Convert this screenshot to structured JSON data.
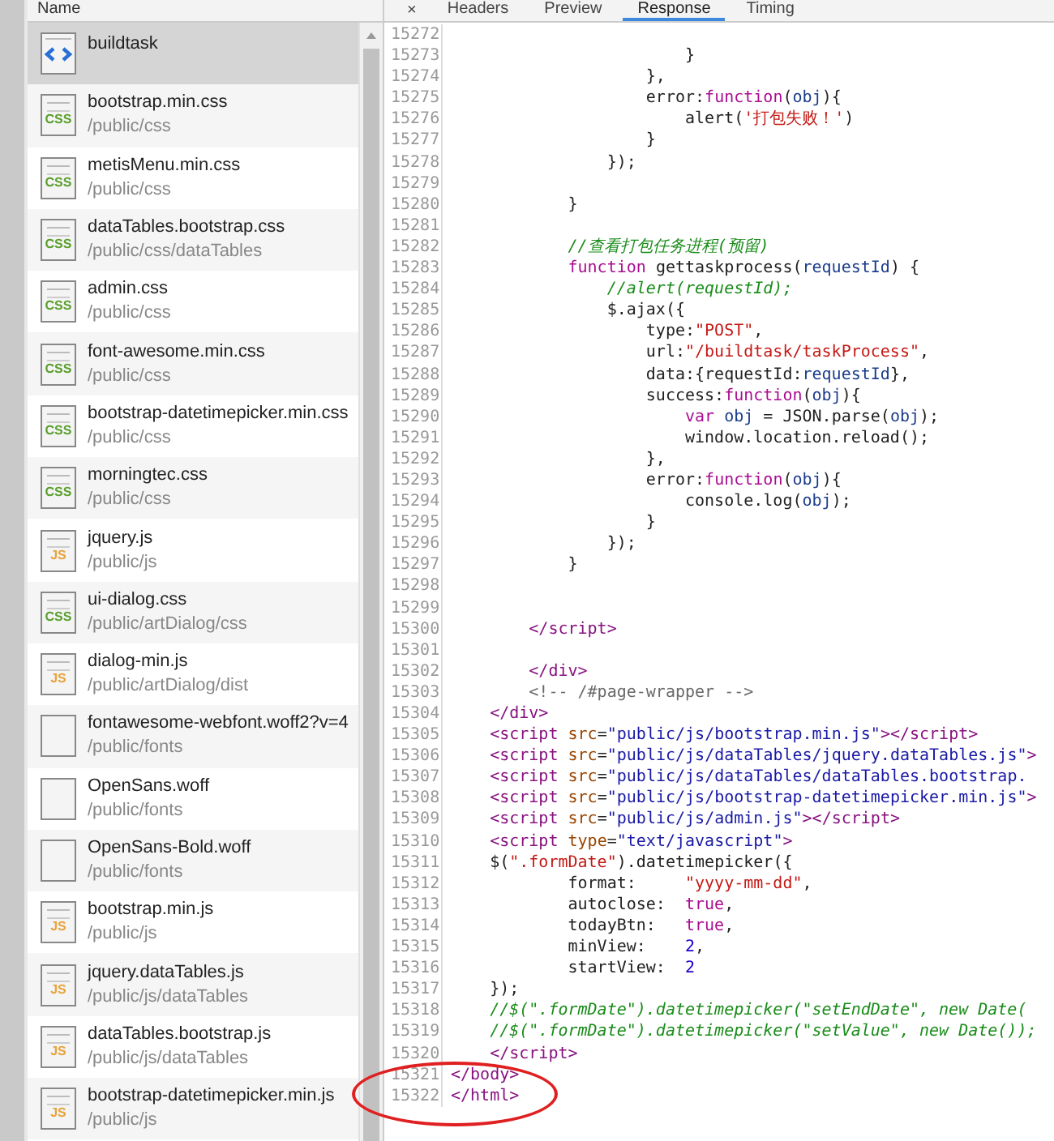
{
  "network_panel": {
    "header": "Name",
    "requests": [
      {
        "name": "buildtask",
        "kind": "html",
        "selected": true
      },
      {
        "name": "bootstrap.min.css",
        "path": "/public/css",
        "kind": "css",
        "icon_text": "CSS",
        "selected": false
      },
      {
        "name": "metisMenu.min.css",
        "path": "/public/css",
        "kind": "css",
        "icon_text": "CSS",
        "selected": false
      },
      {
        "name": "dataTables.bootstrap.css",
        "path": "/public/css/dataTables",
        "kind": "css",
        "icon_text": "CSS",
        "selected": false
      },
      {
        "name": "admin.css",
        "path": "/public/css",
        "kind": "css",
        "icon_text": "CSS",
        "selected": false
      },
      {
        "name": "font-awesome.min.css",
        "path": "/public/css",
        "kind": "css",
        "icon_text": "CSS",
        "selected": false
      },
      {
        "name": "bootstrap-datetimepicker.min.css",
        "path": "/public/css",
        "kind": "css",
        "icon_text": "CSS",
        "selected": false
      },
      {
        "name": "morningtec.css",
        "path": "/public/css",
        "kind": "css",
        "icon_text": "CSS",
        "selected": false
      },
      {
        "name": "jquery.js",
        "path": "/public/js",
        "kind": "js",
        "icon_text": "JS",
        "selected": false
      },
      {
        "name": "ui-dialog.css",
        "path": "/public/artDialog/css",
        "kind": "css",
        "icon_text": "CSS",
        "selected": false
      },
      {
        "name": "dialog-min.js",
        "path": "/public/artDialog/dist",
        "kind": "js",
        "icon_text": "JS",
        "selected": false
      },
      {
        "name": "fontawesome-webfont.woff2?v=4",
        "path": "/public/fonts",
        "kind": "font",
        "selected": false
      },
      {
        "name": "OpenSans.woff",
        "path": "/public/fonts",
        "kind": "font",
        "selected": false
      },
      {
        "name": "OpenSans-Bold.woff",
        "path": "/public/fonts",
        "kind": "font",
        "selected": false
      },
      {
        "name": "bootstrap.min.js",
        "path": "/public/js",
        "kind": "js",
        "icon_text": "JS",
        "selected": false
      },
      {
        "name": "jquery.dataTables.js",
        "path": "/public/js/dataTables",
        "kind": "js",
        "icon_text": "JS",
        "selected": false
      },
      {
        "name": "dataTables.bootstrap.js",
        "path": "/public/js/dataTables",
        "kind": "js",
        "icon_text": "JS",
        "selected": false
      },
      {
        "name": "bootstrap-datetimepicker.min.js",
        "path": "/public/js",
        "kind": "js",
        "icon_text": "JS",
        "selected": false
      }
    ]
  },
  "detail_panel": {
    "close": "×",
    "tabs": [
      {
        "label": "Headers",
        "selected": false
      },
      {
        "label": "Preview",
        "selected": false
      },
      {
        "label": "Response",
        "selected": true
      },
      {
        "label": "Timing",
        "selected": false
      }
    ],
    "code_lines": [
      {
        "number": "15272"
      },
      {
        "number": "15273",
        "tokens": [
          {
            "kind": "plain",
            "text": "                        }"
          }
        ]
      },
      {
        "number": "15274",
        "tokens": [
          {
            "kind": "plain",
            "text": "                    },"
          }
        ]
      },
      {
        "number": "15275",
        "tokens": [
          {
            "kind": "plain",
            "text": "                    error:"
          },
          {
            "kind": "keyword",
            "text": "function"
          },
          {
            "kind": "plain",
            "text": "("
          },
          {
            "kind": "ident",
            "text": "obj"
          },
          {
            "kind": "plain",
            "text": "){"
          }
        ]
      },
      {
        "number": "15276",
        "tokens": [
          {
            "kind": "plain",
            "text": "                        alert("
          },
          {
            "kind": "string",
            "text": "'打包失败！'"
          },
          {
            "kind": "plain",
            "text": ")"
          }
        ]
      },
      {
        "number": "15277",
        "tokens": [
          {
            "kind": "plain",
            "text": "                    }"
          }
        ]
      },
      {
        "number": "15278",
        "tokens": [
          {
            "kind": "plain",
            "text": "                });"
          }
        ]
      },
      {
        "number": "15279"
      },
      {
        "number": "15280",
        "tokens": [
          {
            "kind": "plain",
            "text": "            }"
          }
        ]
      },
      {
        "number": "15281"
      },
      {
        "number": "15282",
        "tokens": [
          {
            "kind": "comment",
            "text": "            //查看打包任务进程(预留)"
          }
        ]
      },
      {
        "number": "15283",
        "tokens": [
          {
            "kind": "keyword",
            "text": "            function"
          },
          {
            "kind": "plain",
            "text": " gettaskprocess("
          },
          {
            "kind": "ident",
            "text": "requestId"
          },
          {
            "kind": "plain",
            "text": ") {"
          }
        ]
      },
      {
        "number": "15284",
        "tokens": [
          {
            "kind": "comment",
            "text": "                //alert(requestId);"
          }
        ]
      },
      {
        "number": "15285",
        "tokens": [
          {
            "kind": "plain",
            "text": "                $.ajax({"
          }
        ]
      },
      {
        "number": "15286",
        "tokens": [
          {
            "kind": "plain",
            "text": "                    type:"
          },
          {
            "kind": "string",
            "text": "\"POST\""
          },
          {
            "kind": "plain",
            "text": ","
          }
        ]
      },
      {
        "number": "15287",
        "tokens": [
          {
            "kind": "plain",
            "text": "                    url:"
          },
          {
            "kind": "string",
            "text": "\"/buildtask/taskProcess\""
          },
          {
            "kind": "plain",
            "text": ","
          }
        ]
      },
      {
        "number": "15288",
        "tokens": [
          {
            "kind": "plain",
            "text": "                    data:{requestId:"
          },
          {
            "kind": "ident",
            "text": "requestId"
          },
          {
            "kind": "plain",
            "text": "},"
          }
        ]
      },
      {
        "number": "15289",
        "tokens": [
          {
            "kind": "plain",
            "text": "                    success:"
          },
          {
            "kind": "keyword",
            "text": "function"
          },
          {
            "kind": "plain",
            "text": "("
          },
          {
            "kind": "ident",
            "text": "obj"
          },
          {
            "kind": "plain",
            "text": "){"
          }
        ]
      },
      {
        "number": "15290",
        "tokens": [
          {
            "kind": "keyword",
            "text": "                        var"
          },
          {
            "kind": "ident",
            "text": " obj"
          },
          {
            "kind": "plain",
            "text": " = JSON.parse("
          },
          {
            "kind": "ident",
            "text": "obj"
          },
          {
            "kind": "plain",
            "text": ");"
          }
        ]
      },
      {
        "number": "15291",
        "tokens": [
          {
            "kind": "plain",
            "text": "                        window.location.reload();"
          }
        ]
      },
      {
        "number": "15292",
        "tokens": [
          {
            "kind": "plain",
            "text": "                    },"
          }
        ]
      },
      {
        "number": "15293",
        "tokens": [
          {
            "kind": "plain",
            "text": "                    error:"
          },
          {
            "kind": "keyword",
            "text": "function"
          },
          {
            "kind": "plain",
            "text": "("
          },
          {
            "kind": "ident",
            "text": "obj"
          },
          {
            "kind": "plain",
            "text": "){"
          }
        ]
      },
      {
        "number": "15294",
        "tokens": [
          {
            "kind": "plain",
            "text": "                        console.log("
          },
          {
            "kind": "ident",
            "text": "obj"
          },
          {
            "kind": "plain",
            "text": ");"
          }
        ]
      },
      {
        "number": "15295",
        "tokens": [
          {
            "kind": "plain",
            "text": "                    }"
          }
        ]
      },
      {
        "number": "15296",
        "tokens": [
          {
            "kind": "plain",
            "text": "                });"
          }
        ]
      },
      {
        "number": "15297",
        "tokens": [
          {
            "kind": "plain",
            "text": "            }"
          }
        ]
      },
      {
        "number": "15298"
      },
      {
        "number": "15299"
      },
      {
        "number": "15300",
        "tokens": [
          {
            "kind": "tag",
            "text": "        </script>"
          }
        ]
      },
      {
        "number": "15301"
      },
      {
        "number": "15302",
        "tokens": [
          {
            "kind": "tag",
            "text": "        </div>"
          }
        ]
      },
      {
        "number": "15303",
        "tokens": [
          {
            "kind": "html-comment",
            "text": "        <!-- /#page-wrapper -->"
          }
        ]
      },
      {
        "number": "15304",
        "tokens": [
          {
            "kind": "tag",
            "text": "    </div>"
          }
        ]
      },
      {
        "number": "15305",
        "tokens": [
          {
            "kind": "tag",
            "text": "    <script"
          },
          {
            "kind": "attr",
            "text": " src"
          },
          {
            "kind": "plain",
            "text": "="
          },
          {
            "kind": "value",
            "text": "\"public/js/bootstrap.min.js\""
          },
          {
            "kind": "tag",
            "text": "></script>"
          }
        ]
      },
      {
        "number": "15306",
        "tokens": [
          {
            "kind": "tag",
            "text": "    <script"
          },
          {
            "kind": "attr",
            "text": " src"
          },
          {
            "kind": "plain",
            "text": "="
          },
          {
            "kind": "value",
            "text": "\"public/js/dataTables/jquery.dataTables.js\""
          },
          {
            "kind": "tag",
            "text": ">"
          }
        ]
      },
      {
        "number": "15307",
        "tokens": [
          {
            "kind": "tag",
            "text": "    <script"
          },
          {
            "kind": "attr",
            "text": " src"
          },
          {
            "kind": "plain",
            "text": "="
          },
          {
            "kind": "value",
            "text": "\"public/js/dataTables/dataTables.bootstrap."
          }
        ]
      },
      {
        "number": "15308",
        "tokens": [
          {
            "kind": "tag",
            "text": "    <script"
          },
          {
            "kind": "attr",
            "text": " src"
          },
          {
            "kind": "plain",
            "text": "="
          },
          {
            "kind": "value",
            "text": "\"public/js/bootstrap-datetimepicker.min.js\""
          },
          {
            "kind": "tag",
            "text": ">"
          }
        ]
      },
      {
        "number": "15309",
        "tokens": [
          {
            "kind": "tag",
            "text": "    <script"
          },
          {
            "kind": "attr",
            "text": " src"
          },
          {
            "kind": "plain",
            "text": "="
          },
          {
            "kind": "value",
            "text": "\"public/js/admin.js\""
          },
          {
            "kind": "tag",
            "text": "></script>"
          }
        ]
      },
      {
        "number": "15310",
        "tokens": [
          {
            "kind": "tag",
            "text": "    <script"
          },
          {
            "kind": "attr",
            "text": " type"
          },
          {
            "kind": "plain",
            "text": "="
          },
          {
            "kind": "value",
            "text": "\"text/javascript\""
          },
          {
            "kind": "tag",
            "text": ">"
          }
        ]
      },
      {
        "number": "15311",
        "tokens": [
          {
            "kind": "plain",
            "text": "    $("
          },
          {
            "kind": "string",
            "text": "\".formDate\""
          },
          {
            "kind": "plain",
            "text": ").datetimepicker({"
          }
        ]
      },
      {
        "number": "15312",
        "tokens": [
          {
            "kind": "plain",
            "text": "            format:     "
          },
          {
            "kind": "string",
            "text": "\"yyyy-mm-dd\""
          },
          {
            "kind": "plain",
            "text": ","
          }
        ]
      },
      {
        "number": "15313",
        "tokens": [
          {
            "kind": "plain",
            "text": "            autoclose:  "
          },
          {
            "kind": "keyword",
            "text": "true"
          },
          {
            "kind": "plain",
            "text": ","
          }
        ]
      },
      {
        "number": "15314",
        "tokens": [
          {
            "kind": "plain",
            "text": "            todayBtn:   "
          },
          {
            "kind": "keyword",
            "text": "true"
          },
          {
            "kind": "plain",
            "text": ","
          }
        ]
      },
      {
        "number": "15315",
        "tokens": [
          {
            "kind": "plain",
            "text": "            minView:    "
          },
          {
            "kind": "number",
            "text": "2"
          },
          {
            "kind": "plain",
            "text": ","
          }
        ]
      },
      {
        "number": "15316",
        "tokens": [
          {
            "kind": "plain",
            "text": "            startView:  "
          },
          {
            "kind": "number",
            "text": "2"
          }
        ]
      },
      {
        "number": "15317",
        "tokens": [
          {
            "kind": "plain",
            "text": "    });"
          }
        ]
      },
      {
        "number": "15318",
        "tokens": [
          {
            "kind": "comment",
            "text": "    //$(\".formDate\").datetimepicker(\"setEndDate\", new Date("
          }
        ]
      },
      {
        "number": "15319",
        "tokens": [
          {
            "kind": "comment",
            "text": "    //$(\".formDate\").datetimepicker(\"setValue\", new Date());"
          }
        ]
      },
      {
        "number": "15320",
        "tokens": [
          {
            "kind": "tag",
            "text": "    </script>"
          }
        ]
      },
      {
        "number": "15321",
        "tokens": [
          {
            "kind": "tag",
            "text": "</body>"
          }
        ]
      },
      {
        "number": "15322",
        "tokens": [
          {
            "kind": "tag",
            "text": "</html>"
          }
        ]
      }
    ]
  }
}
